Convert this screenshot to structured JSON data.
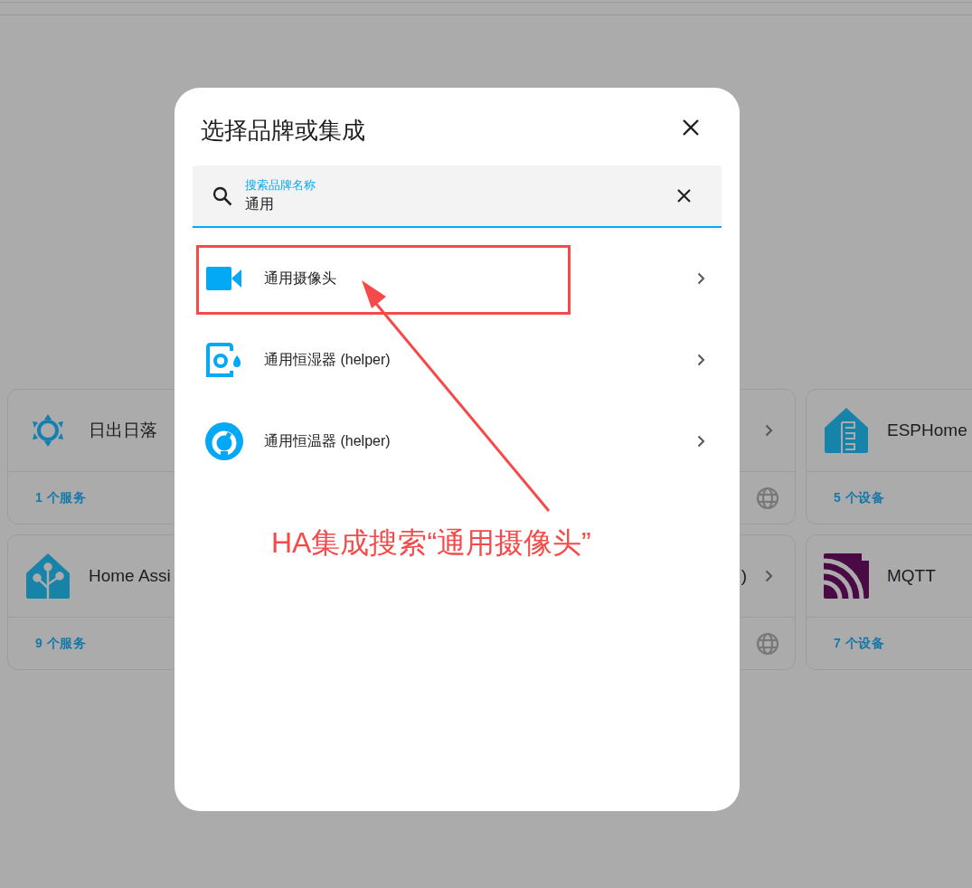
{
  "background_cards": [
    {
      "kind": "sun",
      "title": "日出日落",
      "footer": "1 个服务"
    },
    {
      "kind": "partial"
    },
    {
      "kind": "esphome",
      "title": "ESPHome",
      "footer": "5 个设备"
    },
    {
      "kind": "homeassistant",
      "title": "Home Assi",
      "footer": "9 个服务"
    },
    {
      "kind": "partial",
      "title": ")"
    },
    {
      "kind": "mqtt",
      "title": "MQTT",
      "footer": "7 个设备"
    }
  ],
  "dialog": {
    "title": "选择品牌或集成",
    "search": {
      "label": "搜索品牌名称",
      "value": "通用"
    },
    "results": [
      {
        "kind": "camera",
        "name": "通用摄像头"
      },
      {
        "kind": "humidifier",
        "name": "通用恒湿器 (helper)"
      },
      {
        "kind": "thermostat",
        "name": "通用恒温器 (helper)"
      }
    ]
  },
  "annotation": {
    "text": "HA集成搜索“通用摄像头”"
  }
}
